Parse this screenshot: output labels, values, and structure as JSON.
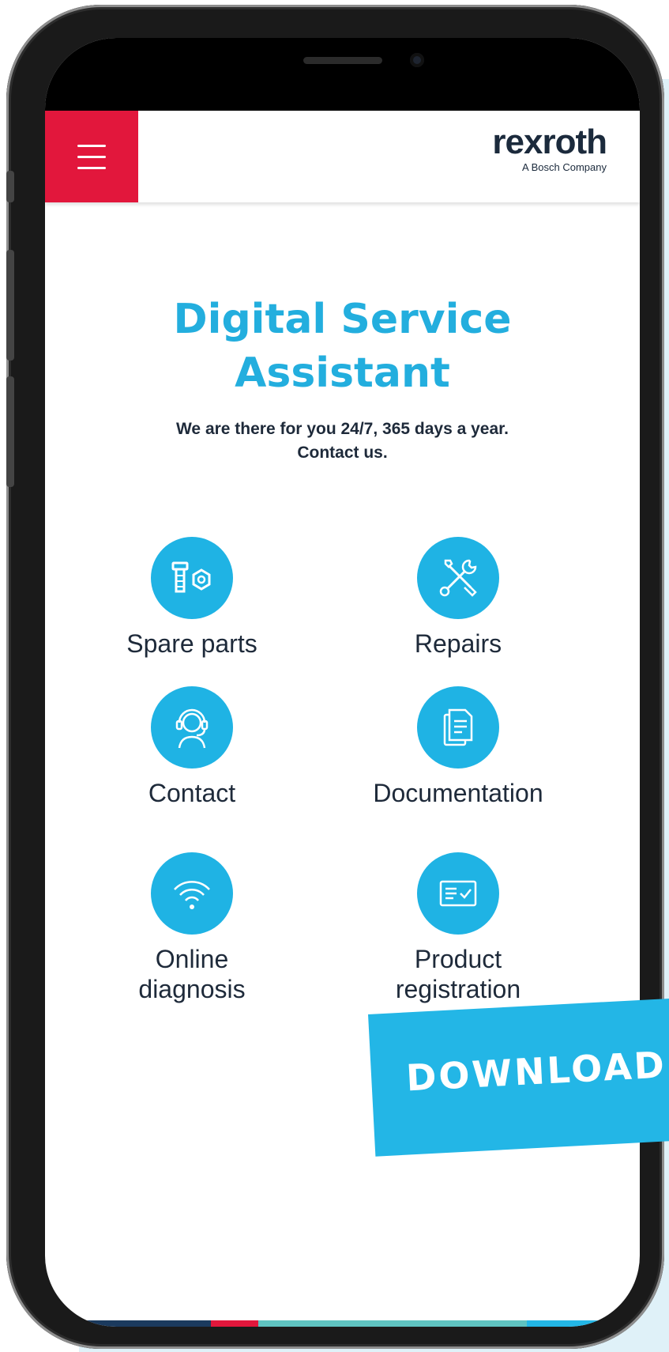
{
  "header": {
    "menu_icon": "hamburger-menu-icon",
    "logo_word": "rexroth",
    "logo_tagline": "A Bosch Company"
  },
  "hero": {
    "title_line1": "Digital Service",
    "title_line2": "Assistant",
    "subtitle_line1": "We are there for you 24/7, 365 days a year.",
    "subtitle_line2": "Contact us."
  },
  "services": [
    {
      "label": "Spare parts",
      "icon": "bolt-nut-icon"
    },
    {
      "label": "Repairs",
      "icon": "wrench-screwdriver-icon"
    },
    {
      "label": "Contact",
      "icon": "headset-icon"
    },
    {
      "label": "Documentation",
      "icon": "document-icon"
    },
    {
      "label_line1": "Online",
      "label_line2": "diagnosis",
      "icon": "wifi-icon"
    },
    {
      "label_line1": "Product",
      "label_line2": "registration",
      "icon": "registration-card-icon"
    }
  ],
  "banner": {
    "text": "DOWNLOAD"
  },
  "colors": {
    "accent_blue": "#23aede",
    "menu_red": "#e2173c",
    "background": "#dff1f8",
    "text_dark": "#1e2a3a"
  }
}
